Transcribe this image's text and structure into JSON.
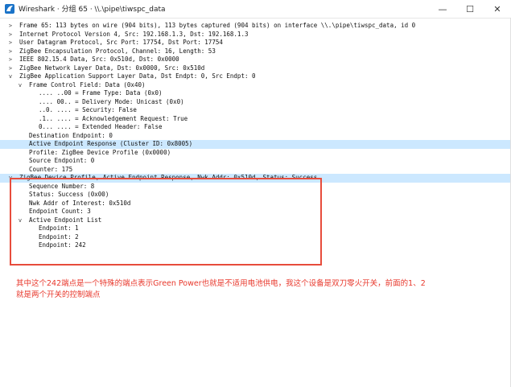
{
  "window": {
    "title": "Wireshark · 分组 65 · \\\\.\\pipe\\tiwspc_data",
    "minimize": "—",
    "maximize": "☐",
    "close": "✕",
    "icon": "wireshark-fin-icon",
    "accent_color": "#1a73c8"
  },
  "packet_tree": [
    {
      "text": "Frame 65: 113 bytes on wire (904 bits), 113 bytes captured (904 bits) on interface \\\\.\\pipe\\tiwspc_data, id 0",
      "toggle": ">",
      "depth": 0
    },
    {
      "text": "Internet Protocol Version 4, Src: 192.168.1.3, Dst: 192.168.1.3",
      "toggle": ">",
      "depth": 0
    },
    {
      "text": "User Datagram Protocol, Src Port: 17754, Dst Port: 17754",
      "toggle": ">",
      "depth": 0
    },
    {
      "text": "ZigBee Encapsulation Protocol, Channel: 16, Length: 53",
      "toggle": ">",
      "depth": 0
    },
    {
      "text": "IEEE 802.15.4 Data, Src: 0x510d, Dst: 0x0000",
      "toggle": ">",
      "depth": 0
    },
    {
      "text": "ZigBee Network Layer Data, Dst: 0x0000, Src: 0x510d",
      "toggle": ">",
      "depth": 0
    },
    {
      "text": "ZigBee Application Support Layer Data, Dst Endpt: 0, Src Endpt: 0",
      "toggle": "v",
      "depth": 0
    },
    {
      "text": "Frame Control Field: Data (0x40)",
      "toggle": "v",
      "depth": 1
    },
    {
      "text": ".... ..00 = Frame Type: Data (0x0)",
      "toggle": "",
      "depth": 2
    },
    {
      "text": ".... 00.. = Delivery Mode: Unicast (0x0)",
      "toggle": "",
      "depth": 2
    },
    {
      "text": "..0. .... = Security: False",
      "toggle": "",
      "depth": 2
    },
    {
      "text": ".1.. .... = Acknowledgement Request: True",
      "toggle": "",
      "depth": 2
    },
    {
      "text": "0... .... = Extended Header: False",
      "toggle": "",
      "depth": 2
    },
    {
      "text": "Destination Endpoint: 0",
      "toggle": "",
      "depth": 1
    },
    {
      "text": "Active Endpoint Response (Cluster ID: 0x8005)",
      "toggle": "",
      "depth": 1,
      "selected": true
    },
    {
      "text": "Profile: ZigBee Device Profile (0x0000)",
      "toggle": "",
      "depth": 1
    },
    {
      "text": "Source Endpoint: 0",
      "toggle": "",
      "depth": 1
    },
    {
      "text": "Counter: 175",
      "toggle": "",
      "depth": 1
    },
    {
      "text": "ZigBee Device Profile, Active Endpoint Response, Nwk Addr: 0x510d, Status: Success",
      "toggle": "v",
      "depth": 0,
      "selected": true
    },
    {
      "text": "Sequence Number: 8",
      "toggle": "",
      "depth": 1
    },
    {
      "text": "Status: Success (0x00)",
      "toggle": "",
      "depth": 1
    },
    {
      "text": "Nwk Addr of Interest: 0x510d",
      "toggle": "",
      "depth": 1
    },
    {
      "text": "Endpoint Count: 3",
      "toggle": "",
      "depth": 1
    },
    {
      "text": "Active Endpoint List",
      "toggle": "v",
      "depth": 1
    },
    {
      "text": "Endpoint: 1",
      "toggle": "",
      "depth": 2
    },
    {
      "text": "Endpoint: 2",
      "toggle": "",
      "depth": 2
    },
    {
      "text": "Endpoint: 242",
      "toggle": "",
      "depth": 2
    }
  ],
  "annotation": {
    "line1": "其中这个242端点是一个特殊的端点表示Green Power也就是不适用电池供电，我这个设备是双刀零火开关，前面的1、2",
    "line2": "就是两个开关的控制端点",
    "color": "#e8382c",
    "box_color": "#e74c3c"
  }
}
